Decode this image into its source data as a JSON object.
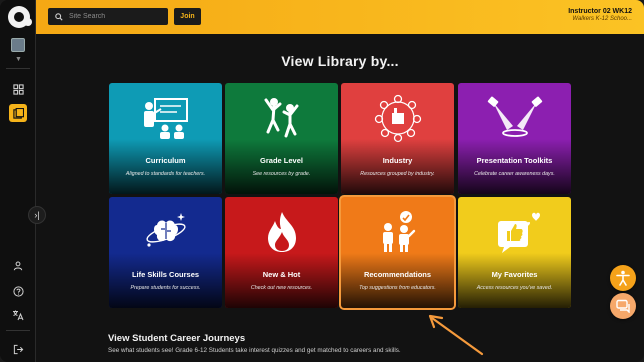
{
  "header": {
    "search_placeholder": "Site Search",
    "join_label": "Join",
    "user_name": "Instructor 02 WK12",
    "user_org": "Walkers K-12 Schoo..."
  },
  "page": {
    "title": "View Library by..."
  },
  "tiles": [
    {
      "name": "Curriculum",
      "desc": "Aligned to standards for teachers.",
      "color": "#0e9bb5",
      "icon": "teacher-board-icon"
    },
    {
      "name": "Grade Level",
      "desc": "See resources by grade.",
      "color": "#0e7a3c",
      "icon": "students-jumping-icon"
    },
    {
      "name": "Industry",
      "desc": "Resources grouped by industry.",
      "color": "#e0403f",
      "icon": "industry-network-icon"
    },
    {
      "name": "Presentation Toolkits",
      "desc": "Celebrate career awareness days.",
      "color": "#8c1fb0",
      "icon": "spotlight-icon"
    },
    {
      "name": "Life Skills Courses",
      "desc": "Prepare students for success.",
      "color": "#132a8f",
      "icon": "brain-icon"
    },
    {
      "name": "New & Hot",
      "desc": "Check out new resources.",
      "color": "#c7191b",
      "icon": "flame-icon"
    },
    {
      "name": "Recommendations",
      "desc": "Top suggestions from educators.",
      "color": "#f07a18",
      "icon": "recommend-people-icon"
    },
    {
      "name": "My Favorites",
      "desc": "Access resources you've saved.",
      "color": "#f1cc1c",
      "icon": "thumbs-up-icon"
    }
  ],
  "journeys": {
    "title": "View Student Career Journeys",
    "desc": "See what students see! Grade 6-12 Students take interest quizzes and get matched to careers and skills."
  }
}
